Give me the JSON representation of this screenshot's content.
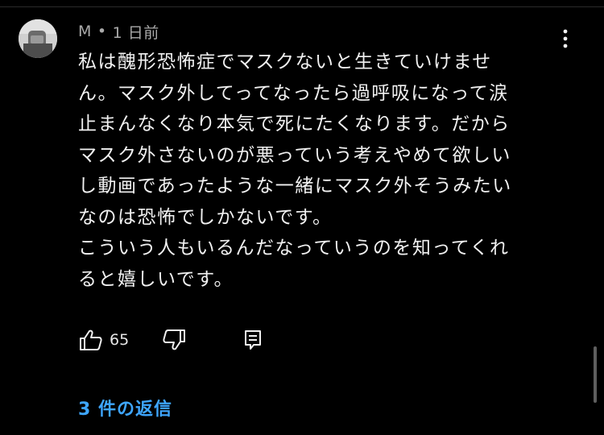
{
  "comment": {
    "author": "M",
    "separator": "•",
    "timestamp": "1 日前",
    "body_lines": [
      "私は醜形恐怖症でマスクないと生きていけませ",
      "ん。マスク外してってなったら過呼吸になって涙",
      "止まんなくなり本気で死にたくなります。だから",
      "マスク外さないのが悪っていう考えやめて欲しい",
      "し動画であったような一緒にマスク外そうみたい",
      "なのは恐怖でしかないです。",
      "こういう人もいるんだなっていうのを知ってくれ",
      "ると嬉しいです。"
    ],
    "like_count": "65",
    "replies_label": "3 件の返信"
  },
  "icons": {
    "menu": "more-vert-icon",
    "like": "thumb-up-icon",
    "dislike": "thumb-down-icon",
    "reply": "reply-comment-icon"
  },
  "colors": {
    "background": "#000000",
    "text": "#f1f1f1",
    "meta": "#aaaaaa",
    "link": "#3ea6ff"
  }
}
